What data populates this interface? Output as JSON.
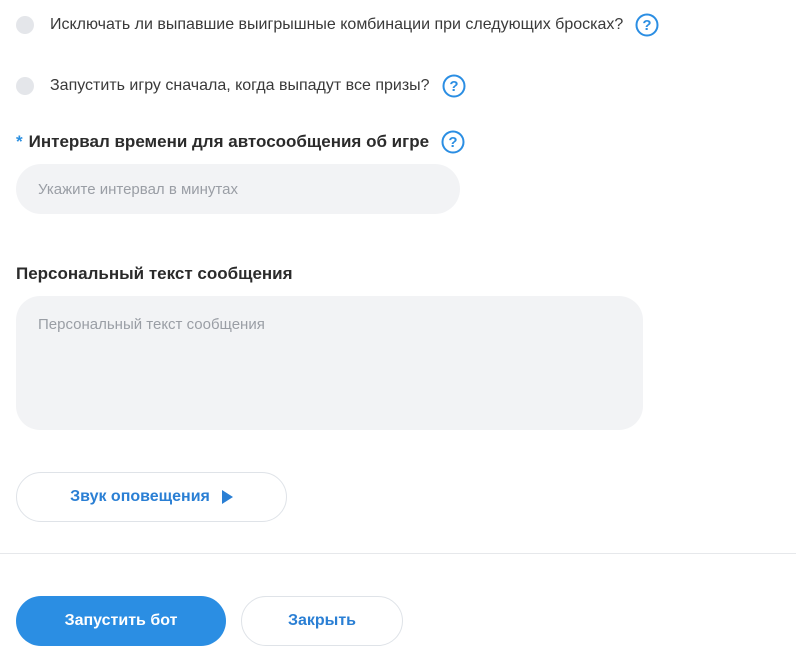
{
  "options": {
    "exclude_combos": {
      "label": "Исключать ли выпавшие выигрышные комбинации при следующих бросках?",
      "checked": false,
      "help_icon": "question-circle-icon"
    },
    "restart_game": {
      "label": "Запустить игру сначала, когда выпадут все призы?",
      "checked": false,
      "help_icon": "question-circle-icon"
    }
  },
  "interval": {
    "required_mark": "*",
    "label": "Интервал времени для автосообщения об игре",
    "placeholder": "Укажите интервал в минутах",
    "value": ""
  },
  "message": {
    "label": "Персональный текст сообщения",
    "placeholder": "Персональный текст сообщения",
    "value": ""
  },
  "sound_button": {
    "label": "Звук оповещения",
    "icon": "play-icon"
  },
  "footer": {
    "start_label": "Запустить бот",
    "close_label": "Закрыть"
  },
  "colors": {
    "accent": "#2b8ee3",
    "field_bg": "#f2f3f5",
    "radio_bg": "#e4e6ea"
  }
}
